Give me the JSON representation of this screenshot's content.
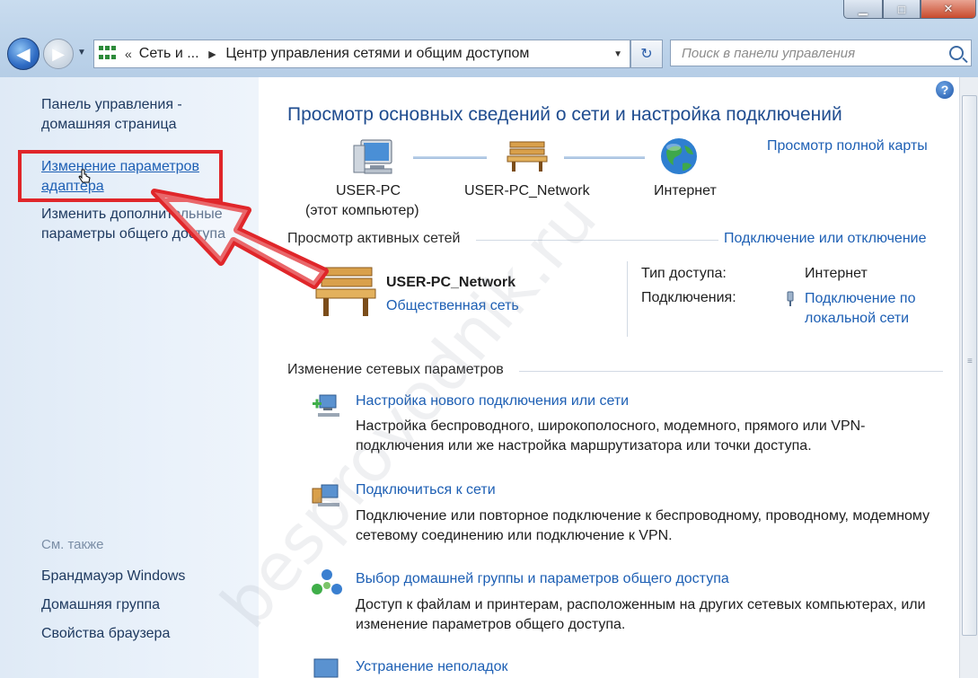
{
  "window": {
    "caption": {
      "minimize": "▁",
      "maximize": "□",
      "close": "✕"
    }
  },
  "nav": {
    "back_icon": "arrow-left-icon",
    "forward_icon": "arrow-right-icon"
  },
  "address": {
    "prefix": "«",
    "crumb1": "Сеть и ...",
    "separator": "►",
    "crumb2": "Центр управления сетями и общим доступом",
    "dropdown": "▼",
    "refresh": "↻"
  },
  "search": {
    "placeholder": "Поиск в панели управления"
  },
  "sidebar": {
    "home_link": "Панель управления - домашняя страница",
    "adapter_link": "Изменение параметров адаптера",
    "sharing_link": "Изменить дополнительные параметры общего доступа",
    "see_also": "См. также",
    "see_also_items": [
      "Брандмауэр Windows",
      "Домашняя группа",
      "Свойства браузера"
    ]
  },
  "main": {
    "title": "Просмотр основных сведений о сети и настройка подключений",
    "full_map_link": "Просмотр полной карты",
    "nodes": [
      {
        "label": "USER-PC",
        "sublabel": "(этот компьютер)"
      },
      {
        "label": "USER-PC_Network"
      },
      {
        "label": "Интернет"
      }
    ],
    "active_networks_title": "Просмотр активных сетей",
    "connect_disconnect_link": "Подключение или отключение",
    "network": {
      "name": "USER-PC_Network",
      "type": "Общественная сеть",
      "access_type_label": "Тип доступа:",
      "access_type_value": "Интернет",
      "connections_label": "Подключения:",
      "connections_value": "Подключение по локальной сети"
    },
    "change_settings_title": "Изменение сетевых параметров",
    "tasks": [
      {
        "link": "Настройка нового подключения или сети",
        "desc": "Настройка беспроводного, широкополосного, модемного, прямого или VPN-подключения или же настройка маршрутизатора или точки доступа."
      },
      {
        "link": "Подключиться к сети",
        "desc": "Подключение или повторное подключение к беспроводному, проводному, модемному сетевому соединению или подключение к VPN."
      },
      {
        "link": "Выбор домашней группы и параметров общего доступа",
        "desc": "Доступ к файлам и принтерам, расположенным на других сетевых компьютерах, или изменение параметров общего доступа."
      },
      {
        "link": "Устранение неполадок"
      }
    ]
  },
  "help": "?",
  "watermark": "besprovodnik.ru",
  "colors": {
    "link": "#1d5fb4",
    "title": "#1f4c8f",
    "highlight": "#e0262a"
  }
}
